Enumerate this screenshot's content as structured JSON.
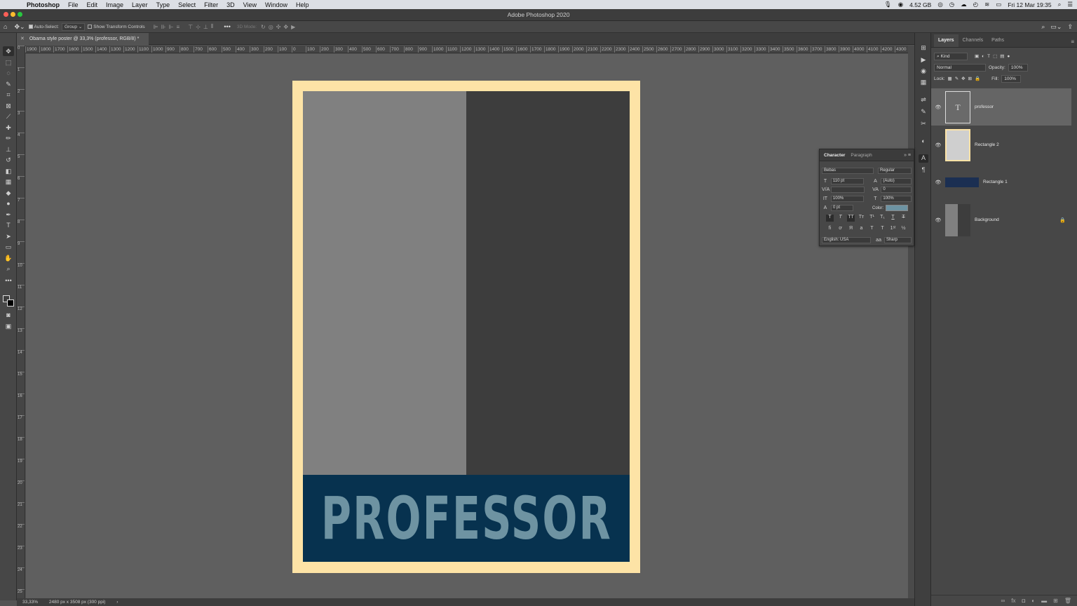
{
  "menubar": {
    "app": "Photoshop",
    "items": [
      "File",
      "Edit",
      "Image",
      "Layer",
      "Type",
      "Select",
      "Filter",
      "3D",
      "View",
      "Window",
      "Help"
    ],
    "memory": "4.52 GB",
    "datetime": "Fri 12 Mar  19:35"
  },
  "window": {
    "title": "Adobe Photoshop 2020"
  },
  "options": {
    "auto_select_label": "Auto-Select:",
    "auto_select_value": "Group",
    "show_transform_label": "Show Transform Controls",
    "mode3d_label": "3D Mode:"
  },
  "document": {
    "tab_title": "Obama style poster @ 33,3% (professor, RGB/8) *",
    "poster_text": "PROFESSOR",
    "colors": {
      "border": "#fde3a6",
      "left": "#808080",
      "right": "#3d3d3d",
      "band": "#07324f",
      "text": "#6e93a2"
    }
  },
  "ruler": {
    "h_ticks": [
      "1900",
      "1800",
      "1700",
      "1600",
      "1500",
      "1400",
      "1300",
      "1200",
      "1100",
      "1000",
      "900",
      "800",
      "700",
      "600",
      "500",
      "400",
      "300",
      "200",
      "100",
      "0",
      "100",
      "200",
      "300",
      "400",
      "500",
      "600",
      "700",
      "800",
      "900",
      "1000",
      "1100",
      "1200",
      "1300",
      "1400",
      "1500",
      "1600",
      "1700",
      "1800",
      "1900",
      "2000",
      "2100",
      "2200",
      "2300",
      "2400",
      "2500",
      "2600",
      "2700",
      "2800",
      "2900",
      "3000",
      "3100",
      "3200",
      "3300",
      "3400",
      "3500",
      "3600",
      "3700",
      "3800",
      "3900",
      "4000",
      "4100",
      "4200",
      "4300"
    ],
    "v_ticks": [
      "0",
      "1",
      "2",
      "3",
      "4",
      "5",
      "6",
      "7",
      "8",
      "9",
      "10",
      "11",
      "12",
      "13",
      "14",
      "15",
      "16",
      "17",
      "18",
      "19",
      "20",
      "21",
      "22",
      "23",
      "24",
      "25"
    ]
  },
  "status": {
    "zoom": "33,33%",
    "doc_info": "2480 px x 3508 px (300 ppi)"
  },
  "layers_panel": {
    "tabs": [
      "Layers",
      "Channels",
      "Paths"
    ],
    "filter": "Kind",
    "blend_mode": "Normal",
    "opacity_label": "Opacity:",
    "opacity": "100%",
    "lock_label": "Lock:",
    "fill_label": "Fill:",
    "fill": "100%",
    "layers": [
      {
        "name": "professor"
      },
      {
        "name": "Rectangle 2"
      },
      {
        "name": "Rectangle 1"
      },
      {
        "name": "Background"
      }
    ]
  },
  "character_panel": {
    "tabs": [
      "Character",
      "Paragraph"
    ],
    "font": "Bebas",
    "style": "Regular",
    "size": "110 pt",
    "leading": "(Auto)",
    "kerning": "",
    "tracking": "0",
    "vscale": "100%",
    "hscale": "100%",
    "baseline": "0 pt",
    "color_label": "Color:",
    "color": "#6d93a3",
    "language": "English: USA",
    "antialias": "Sharp"
  }
}
